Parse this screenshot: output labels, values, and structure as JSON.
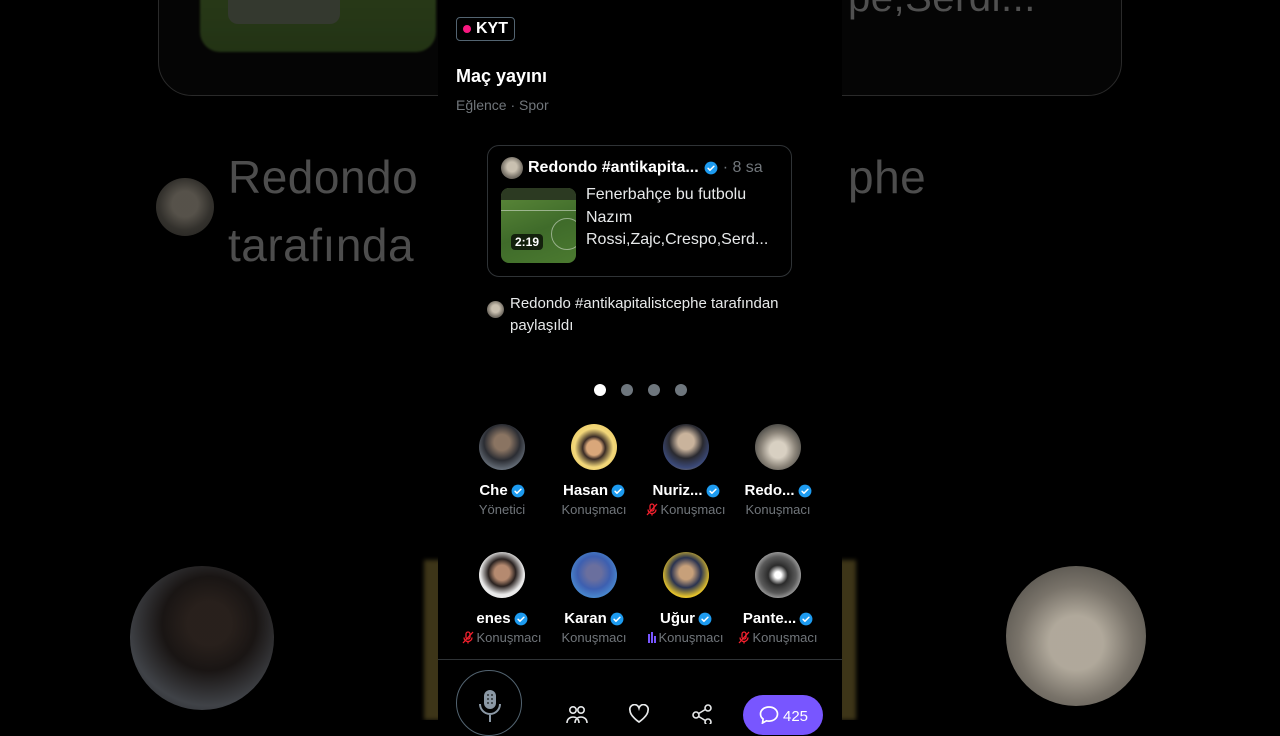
{
  "background": {
    "text_line1": "Redondo",
    "text_line1_right": "phe",
    "text_line2": "tarafında",
    "top_right_text": "pe,Serdi..."
  },
  "space": {
    "badge": "KYT",
    "title": "Maç yayını",
    "subtitle": "Eğlence · Spor"
  },
  "pinned_tweet": {
    "author": "Redondo #antikapita...",
    "time": "· 8 sa",
    "video_duration": "2:19",
    "text_lines": [
      "Fenerbahçe bu futbolu",
      "Nazım",
      "Rossi,Zajc,Crespo,Serd..."
    ]
  },
  "shared_by": "Redondo #antikapitalistcephe tarafından paylaşıldı",
  "carousel": {
    "pages": 4,
    "active": 0
  },
  "speakers": [
    {
      "name": "Che",
      "role": "Yönetici",
      "verified": true,
      "status": "none"
    },
    {
      "name": "Hasan",
      "role": "Konuşmacı",
      "verified": true,
      "status": "none"
    },
    {
      "name": "Nuriz...",
      "role": "Konuşmacı",
      "verified": true,
      "status": "muted"
    },
    {
      "name": "Redo...",
      "role": "Konuşmacı",
      "verified": true,
      "status": "none"
    },
    {
      "name": "enes",
      "role": "Konuşmacı",
      "verified": true,
      "status": "muted"
    },
    {
      "name": "Karan",
      "role": "Konuşmacı",
      "verified": true,
      "status": "none"
    },
    {
      "name": "Uğur",
      "role": "Konuşmacı",
      "verified": true,
      "status": "talking"
    },
    {
      "name": "Pante...",
      "role": "Konuşmacı",
      "verified": true,
      "status": "muted"
    }
  ],
  "bottom_bar": {
    "mic_icon": "microphone-icon",
    "people_icon": "people-icon",
    "heart_icon": "heart-icon",
    "share_icon": "share-icon",
    "comments_count": "425"
  },
  "colors": {
    "accent": "#7856ff",
    "verified": "#1d9bf0",
    "live": "#f91880",
    "muted": "#f4212e"
  }
}
